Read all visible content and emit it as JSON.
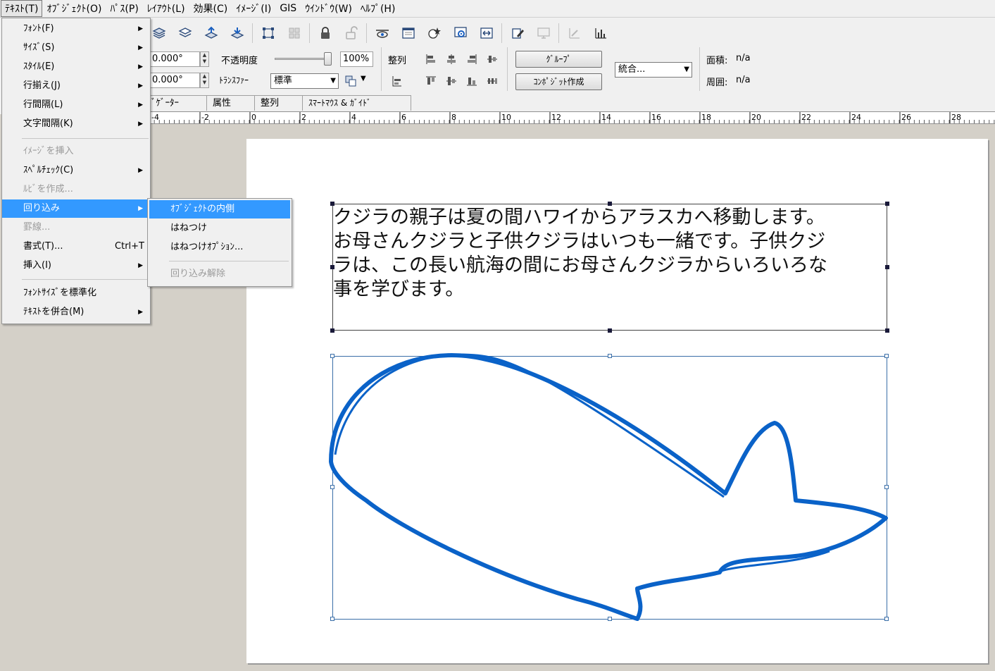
{
  "menubar": {
    "items": [
      "ﾃｷｽﾄ(T)",
      "ｵﾌﾞｼﾞｪｸﾄ(O)",
      "ﾊﾟｽ(P)",
      "ﾚｲｱｳﾄ(L)",
      "効果(C)",
      "ｲﾒｰｼﾞ(I)",
      "GIS",
      "ｳｲﾝﾄﾞｳ(W)",
      "ﾍﾙﾌﾟ(H)"
    ]
  },
  "toolbar": {
    "icons": [
      "layers-icon",
      "layers-stack-icon",
      "bring-forward-icon",
      "send-backward-icon",
      "group-frame-icon",
      "ungroup-frame-icon",
      "lock-icon",
      "unlock-icon",
      "view-icon",
      "window-icon",
      "star-stamp-icon",
      "gear-screen-icon",
      "fit-width-icon",
      "edit-document-icon",
      "monitor-icon",
      "pen-chart-icon",
      "bar-chart-icon"
    ],
    "angle1": "0.000°",
    "angle2": "0.000°",
    "opacity_label": "不透明度",
    "opacity_value": "100%",
    "opacity_level": 1.0,
    "transfer_label": "ﾄﾗﾝｽﾌｧｰ",
    "transfer_value": "標準",
    "align_label": "整列",
    "group_button": "ｸﾞﾙｰﾌﾟ",
    "composite_button": "ｺﾝﾎﾟｼﾞｯﾄ作成",
    "combine_select": "統合...",
    "area_label": "面積:",
    "area_value": "n/a",
    "perimeter_label": "周囲:",
    "perimeter_value": "n/a"
  },
  "tabs": [
    "ﾞｹﾞｰﾀｰ",
    "属性",
    "整列",
    "ｽﾏｰﾄﾏｳｽ & ｶﾞｲﾄﾞ"
  ],
  "ruler": {
    "labels": [
      "-4",
      "-2",
      "0",
      "2",
      "4",
      "6",
      "8",
      "10",
      "12",
      "14",
      "16",
      "18",
      "20",
      "22",
      "24",
      "26",
      "28"
    ]
  },
  "document": {
    "text_lines": [
      "クジラの親子は夏の間ハワイからアラスカへ移動します。",
      "お母さんクジラと子供クジラはいつも一緒です。子供クジ",
      "ラは、この長い航海の間にお母さんクジラからいろいろな",
      "事を学びます。"
    ],
    "shape_color": "#0a62c8"
  },
  "text_menu": {
    "items": [
      {
        "label": "ﾌｫﾝﾄ(F)",
        "submenu": true
      },
      {
        "label": "ｻｲｽﾞ(S)",
        "submenu": true
      },
      {
        "label": "ｽﾀｲﾙ(E)",
        "submenu": true
      },
      {
        "label": "行揃え(J)",
        "submenu": true
      },
      {
        "label": "行間隔(L)",
        "submenu": true
      },
      {
        "label": "文字間隔(K)",
        "submenu": true
      },
      {
        "label": "ｲﾒｰｼﾞを挿入",
        "disabled": true
      },
      {
        "label": "ｽﾍﾟﾙﾁｪｯｸ(C)",
        "submenu": true
      },
      {
        "label": "ﾙﾋﾞを作成...",
        "disabled": true
      },
      {
        "label": "回り込み",
        "submenu": true,
        "highlighted": true
      },
      {
        "label": "罫線...",
        "disabled": true
      },
      {
        "label": "書式(T)...",
        "shortcut": "Ctrl+T"
      },
      {
        "label": "挿入(I)",
        "submenu": true
      },
      {
        "label": "ﾌｫﾝﾄｻｲｽﾞを標準化"
      },
      {
        "label": "ﾃｷｽﾄを併合(M)",
        "submenu": true
      }
    ]
  },
  "wrap_submenu": {
    "items": [
      {
        "label": "ｵﾌﾞｼﾞｪｸﾄの内側",
        "highlighted": true
      },
      {
        "label": "はねつけ"
      },
      {
        "label": "はねつけｵﾌﾟｼｮﾝ..."
      },
      {
        "label": "回り込み解除",
        "disabled": true
      }
    ]
  }
}
